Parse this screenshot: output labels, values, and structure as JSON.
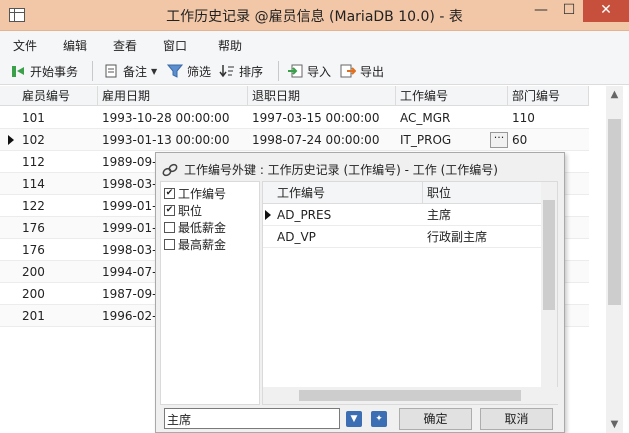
{
  "window": {
    "title": "工作历史记录 @雇员信息 (MariaDB 10.0) - 表",
    "min": "—",
    "max": "☐",
    "close": "✕"
  },
  "menu": [
    "文件",
    "编辑",
    "查看",
    "窗口",
    "帮助"
  ],
  "toolbar": {
    "begin_tx": "开始事务",
    "note": "备注",
    "filter": "筛选",
    "sort": "排序",
    "import": "导入",
    "export": "导出"
  },
  "grid": {
    "columns": [
      "雇员编号",
      "雇用日期",
      "退职日期",
      "工作编号",
      "部门编号"
    ],
    "rows": [
      [
        "101",
        "1993-10-28 00:00:00",
        "1997-03-15 00:00:00",
        "AC_MGR",
        "110"
      ],
      [
        "102",
        "1993-01-13 00:00:00",
        "1998-07-24 00:00:00",
        "IT_PROG",
        "60"
      ],
      [
        "112",
        "1989-09-",
        "",
        "",
        ""
      ],
      [
        "114",
        "1998-03-",
        "",
        "",
        ""
      ],
      [
        "122",
        "1999-01-",
        "",
        "",
        ""
      ],
      [
        "176",
        "1999-01-",
        "",
        "",
        ""
      ],
      [
        "176",
        "1998-03-",
        "",
        "",
        ""
      ],
      [
        "200",
        "1994-07-",
        "",
        "",
        ""
      ],
      [
        "200",
        "1987-09-",
        "",
        "",
        ""
      ],
      [
        "201",
        "1996-02-",
        "",
        "",
        ""
      ]
    ],
    "ellipsis": "···"
  },
  "popup": {
    "title": "工作编号外键 : 工作历史记录 (工作编号) - 工作 (工作编号)",
    "columns_list": [
      {
        "label": "工作编号",
        "checked": "✔"
      },
      {
        "label": "职位",
        "checked": "✔"
      },
      {
        "label": "最低薪金",
        "checked": ""
      },
      {
        "label": "最高薪金",
        "checked": ""
      }
    ],
    "ref_headers": [
      "工作编号",
      "职位"
    ],
    "ref_rows": [
      [
        "AD_PRES",
        "主席"
      ],
      [
        "AD_VP",
        "行政副主席"
      ]
    ],
    "filter_value": "主席",
    "ok": "确定",
    "cancel": "取消"
  }
}
